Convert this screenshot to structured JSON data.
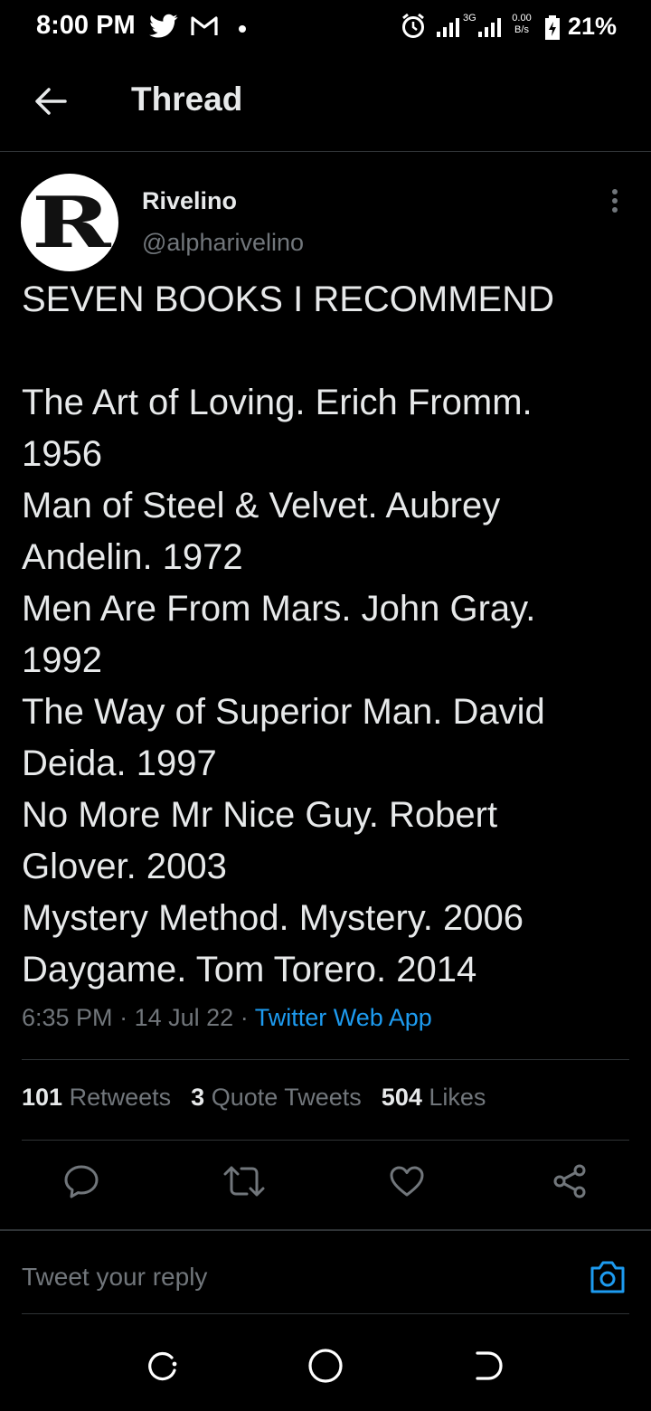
{
  "status_bar": {
    "time": "8:00 PM",
    "net_speed_value": "0.00",
    "net_speed_unit": "B/s",
    "network_type": "3G",
    "battery": "21%",
    "icons": [
      "twitter-icon",
      "gmail-icon",
      "notification-dot-icon",
      "alarm-icon",
      "signal-icon",
      "signal-icon",
      "battery-charging-icon"
    ]
  },
  "header": {
    "title": "Thread",
    "back_icon": "arrow-left-icon"
  },
  "tweet": {
    "author_name": "Rivelino",
    "author_handle": "@alpharivelino",
    "avatar_letter": "R",
    "more_icon": "more-vertical-icon",
    "lines": [
      "SEVEN BOOKS I RECOMMEND",
      "",
      "The Art of Loving. Erich Fromm.",
      "1956",
      "Man of Steel & Velvet. Aubrey",
      "Andelin. 1972",
      "Men Are From Mars. John Gray.",
      "1992",
      "The Way of Superior Man. David",
      "Deida. 1997",
      "No More Mr Nice Guy. Robert",
      "Glover. 2003",
      "Mystery Method. Mystery. 2006",
      "Daygame. Tom Torero. 2014"
    ],
    "time": "6:35 PM",
    "date": "14 Jul 22",
    "separator": "·",
    "source": "Twitter Web App"
  },
  "stats": {
    "retweets_count": "101",
    "retweets_label": "Retweets",
    "quotes_count": "3",
    "quotes_label": "Quote Tweets",
    "likes_count": "504",
    "likes_label": "Likes"
  },
  "actions": [
    "reply-icon",
    "retweet-icon",
    "like-icon",
    "share-icon"
  ],
  "reply_box": {
    "placeholder": "Tweet your reply",
    "camera_icon": "camera-icon"
  },
  "nav_bar": [
    "recents-icon",
    "home-icon",
    "back-icon"
  ],
  "colors": {
    "background": "#000000",
    "text": "#e7e9ea",
    "muted": "#71767b",
    "accent": "#1d9bf0",
    "divider": "#2f3336"
  }
}
